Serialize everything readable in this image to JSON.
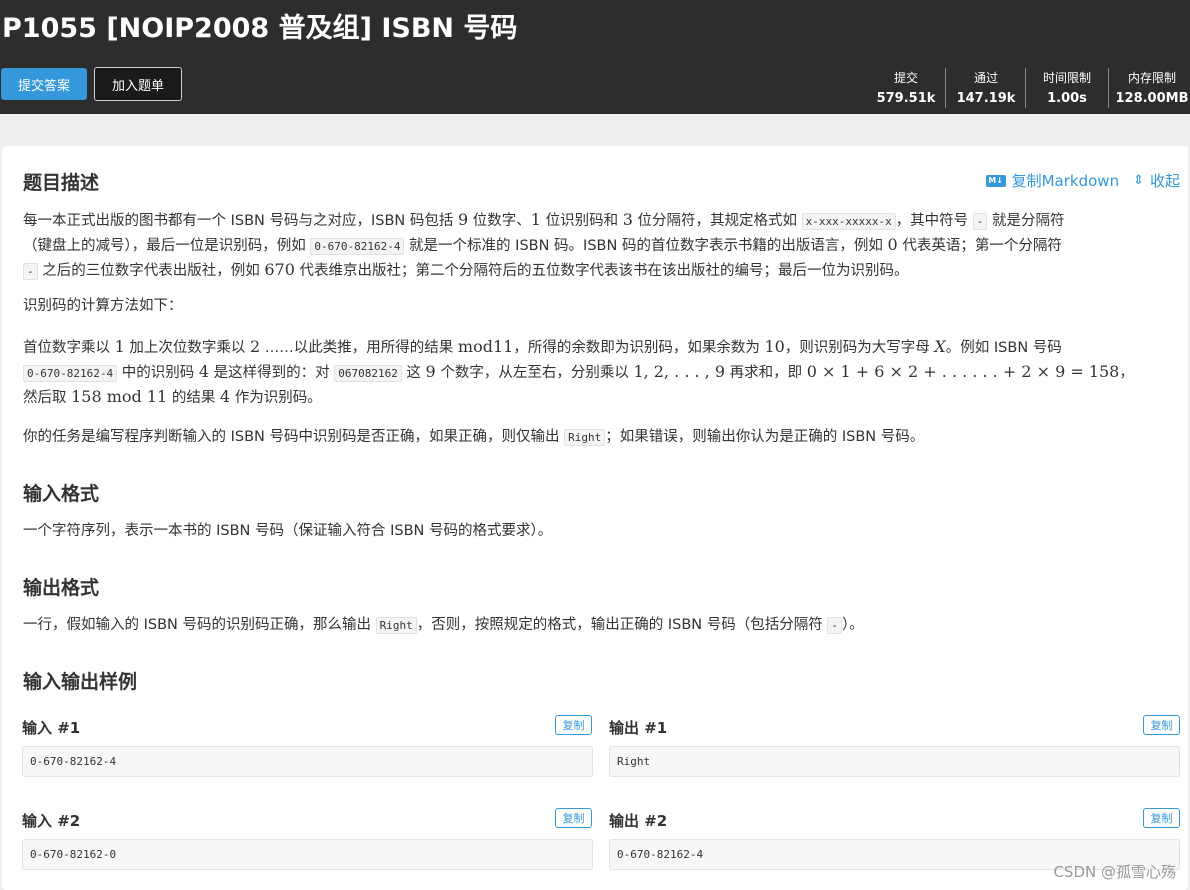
{
  "header": {
    "title": "P1055 [NOIP2008 普及组] ISBN 号码",
    "submit_label": "提交答案",
    "add_label": "加入题单",
    "stats": [
      {
        "label": "提交",
        "value": "579.51k"
      },
      {
        "label": "通过",
        "value": "147.19k"
      },
      {
        "label": "时间限制",
        "value": "1.00s"
      },
      {
        "label": "内存限制",
        "value": "128.00MB"
      }
    ]
  },
  "description": {
    "heading": "题目描述",
    "copy_md_label": "复制Markdown",
    "collapse_label": "收起",
    "md_icon_text": "M↓",
    "p1": {
      "a": "每一本正式出版的图书都有一个 ISBN 号码与之对应，ISBN 码包括 ",
      "n9": "9",
      "b": " 位数字、",
      "n1": "1",
      "c": " 位识别码和 ",
      "n3": "3",
      "d": " 位分隔符，其规定格式如 ",
      "code_fmt": "x-xxx-xxxxx-x",
      "e": "，其中符号 ",
      "code_dash1": "-",
      "f": " 就是分隔符",
      "g": "（键盘上的减号），最后一位是识别码，例如 ",
      "code_ex": "0-670-82162-4",
      "h": " 就是一个标准的 ISBN 码。ISBN 码的首位数字表示书籍的出版语言，例如 ",
      "n0": "0",
      "i": " 代表英语；第一个分隔符",
      "code_dash2": "-",
      "j": " 之后的三位数字代表出版社，例如 ",
      "n670": "670",
      "k": " 代表维京出版社；第二个分隔符后的五位数字代表该书在该出版社的编号；最后一位为识别码。"
    },
    "p2": "识别码的计算方法如下：",
    "p3": {
      "a": "首位数字乘以 ",
      "n1": "1",
      "b": " 加上次位数字乘以 ",
      "n2": "2",
      "c": " ……以此类推，用所得的结果 ",
      "mod11": "mod11",
      "d": "，所得的余数即为识别码，如果余数为 ",
      "n10": "10",
      "e": "，则识别码为大写字母 ",
      "X": "X",
      "f": "。例如 ISBN 号码",
      "code_ex": "0-670-82162-4",
      "g": " 中的识别码 ",
      "n4": "4",
      "h": " 是这样得到的：对 ",
      "code_digits": "067082162",
      "i": " 这 ",
      "n9": "9",
      "j": " 个数字，从左至右，分别乘以 ",
      "seq": "1, 2, . . . , 9",
      "k": " 再求和，即 ",
      "formula": "0 × 1 + 6 × 2 + . . . . . . + 2 × 9 = 158",
      "l": "，",
      "m": "然后取 ",
      "n158": "158 mod 11",
      "n": " 的结果 ",
      "n4b": "4",
      "o": " 作为识别码。"
    },
    "p4": {
      "a": "你的任务是编写程序判断输入的 ISBN 号码中识别码是否正确，如果正确，则仅输出 ",
      "code_right": "Right",
      "b": "；如果错误，则输出你认为是正确的 ISBN 号码。"
    }
  },
  "input_format": {
    "heading": "输入格式",
    "text": "一个字符序列，表示一本书的 ISBN 号码（保证输入符合 ISBN 号码的格式要求）。"
  },
  "output_format": {
    "heading": "输出格式",
    "a": "一行，假如输入的 ISBN 号码的识别码正确，那么输出 ",
    "code_right": "Right",
    "b": "，否则，按照规定的格式，输出正确的 ISBN 号码（包括分隔符 ",
    "code_dash": "-",
    "c": "）。"
  },
  "samples": {
    "heading": "输入输出样例",
    "copy_label": "复制",
    "items": [
      {
        "in_label": "输入 #1",
        "in_value": "0-670-82162-4",
        "out_label": "输出 #1",
        "out_value": "Right"
      },
      {
        "in_label": "输入 #2",
        "in_value": "0-670-82162-0",
        "out_label": "输出 #2",
        "out_value": "0-670-82162-4"
      }
    ]
  },
  "watermark": "CSDN @孤雪心殇"
}
